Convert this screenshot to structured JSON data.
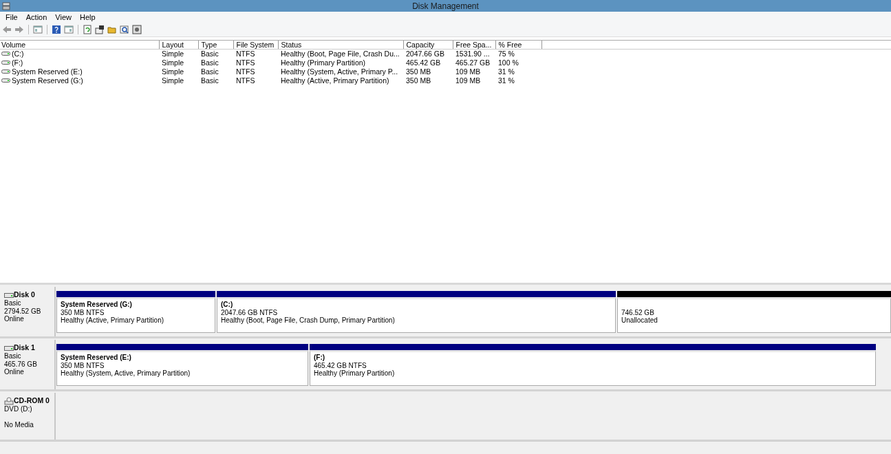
{
  "window": {
    "title": "Disk Management"
  },
  "menu": [
    "File",
    "Action",
    "View",
    "Help"
  ],
  "volume_table": {
    "columns": [
      "Volume",
      "Layout",
      "Type",
      "File System",
      "Status",
      "Capacity",
      "Free Spa...",
      "% Free"
    ],
    "rows": [
      {
        "cells": [
          "(C:)",
          "Simple",
          "Basic",
          "NTFS",
          "Healthy (Boot, Page File, Crash Du...",
          "2047.66 GB",
          "1531.90 ...",
          "75 %"
        ]
      },
      {
        "cells": [
          "(F:)",
          "Simple",
          "Basic",
          "NTFS",
          "Healthy (Primary Partition)",
          "465.42 GB",
          "465.27 GB",
          "100 %"
        ]
      },
      {
        "cells": [
          "System Reserved (E:)",
          "Simple",
          "Basic",
          "NTFS",
          "Healthy (System, Active, Primary P...",
          "350 MB",
          "109 MB",
          "31 %"
        ]
      },
      {
        "cells": [
          "System Reserved (G:)",
          "Simple",
          "Basic",
          "NTFS",
          "Healthy (Active, Primary Partition)",
          "350 MB",
          "109 MB",
          "31 %"
        ]
      }
    ]
  },
  "disks": [
    {
      "kind": "disk",
      "name": "Disk 0",
      "lines": [
        "Basic",
        "2794.52 GB",
        "Online"
      ],
      "partitions": [
        {
          "kind": "primary",
          "title": "System Reserved  (G:)",
          "lines": [
            "350 MB NTFS",
            "Healthy (Active, Primary Partition)"
          ]
        },
        {
          "kind": "primary",
          "title": "(C:)",
          "lines": [
            "2047.66 GB NTFS",
            "Healthy (Boot, Page File, Crash Dump, Primary Partition)"
          ]
        },
        {
          "kind": "unallocated",
          "lines": [
            "746.52 GB",
            "Unallocated"
          ]
        }
      ]
    },
    {
      "kind": "disk",
      "name": "Disk 1",
      "lines": [
        "Basic",
        "465.76 GB",
        "Online"
      ],
      "partitions": [
        {
          "kind": "primary",
          "title": "System Reserved  (E:)",
          "lines": [
            "350 MB NTFS",
            "Healthy (System, Active, Primary Partition)"
          ]
        },
        {
          "kind": "primary",
          "title": "(F:)",
          "lines": [
            "465.42 GB NTFS",
            "Healthy (Primary Partition)"
          ]
        }
      ]
    },
    {
      "kind": "cdrom",
      "name": "CD-ROM 0",
      "lines": [
        "DVD (D:)",
        "No Media"
      ]
    }
  ]
}
